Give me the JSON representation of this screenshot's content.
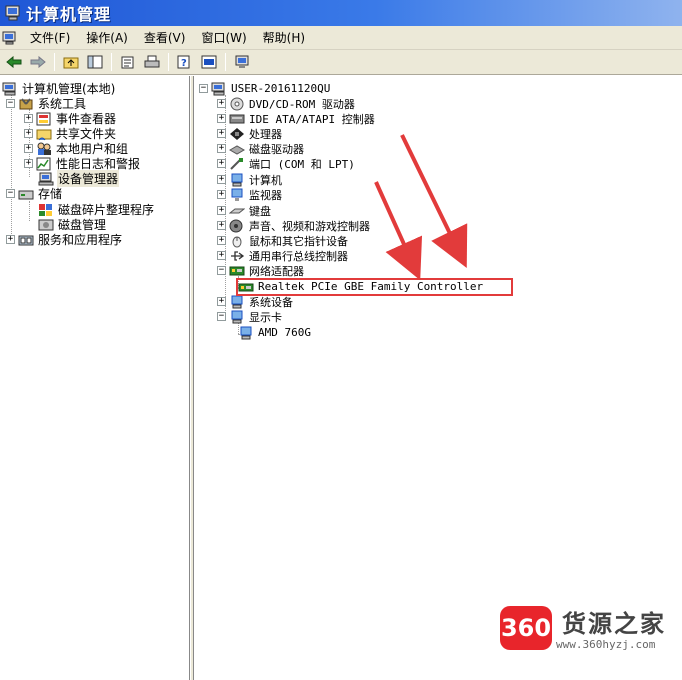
{
  "window": {
    "title": "计算机管理"
  },
  "menu": [
    "文件(F)",
    "操作(A)",
    "查看(V)",
    "窗口(W)",
    "帮助(H)"
  ],
  "toolbar_icons": [
    "back-arrow-icon",
    "forward-arrow-icon",
    "up-folder-icon",
    "show-hide-tree-icon",
    "properties-icon",
    "print-icon",
    "help-icon",
    "console-tree-icon",
    "scan-hardware-icon"
  ],
  "left_tree": {
    "root": "计算机管理(本地)",
    "system_tools": "系统工具",
    "event_viewer": "事件查看器",
    "shared_folders": "共享文件夹",
    "local_users": "本地用户和组",
    "perf_logs": "性能日志和警报",
    "device_manager": "设备管理器",
    "storage": "存储",
    "defrag": "磁盘碎片整理程序",
    "disk_mgmt": "磁盘管理",
    "services_apps": "服务和应用程序"
  },
  "right_tree": {
    "computer_name": "USER-20161120QU",
    "dvd": "DVD/CD-ROM 驱动器",
    "ide": "IDE ATA/ATAPI 控制器",
    "cpu": "处理器",
    "disk": "磁盘驱动器",
    "ports": "端口 (COM 和 LPT)",
    "computer": "计算机",
    "monitor": "监视器",
    "keyboard": "键盘",
    "sound": "声音、视频和游戏控制器",
    "mouse": "鼠标和其它指针设备",
    "usb": "通用串行总线控制器",
    "network": "网络适配器",
    "nic": "Realtek PCIe GBE Family Controller",
    "system_devices": "系统设备",
    "display": "显示卡",
    "gpu": "AMD 760G"
  },
  "watermark": {
    "badge": "360",
    "name": "货源之家",
    "url": "www.360hyzj.com"
  },
  "colors": {
    "highlight": "#e23b3b",
    "arrow": "#e23b3b",
    "titlebar": "#2a64dc"
  }
}
